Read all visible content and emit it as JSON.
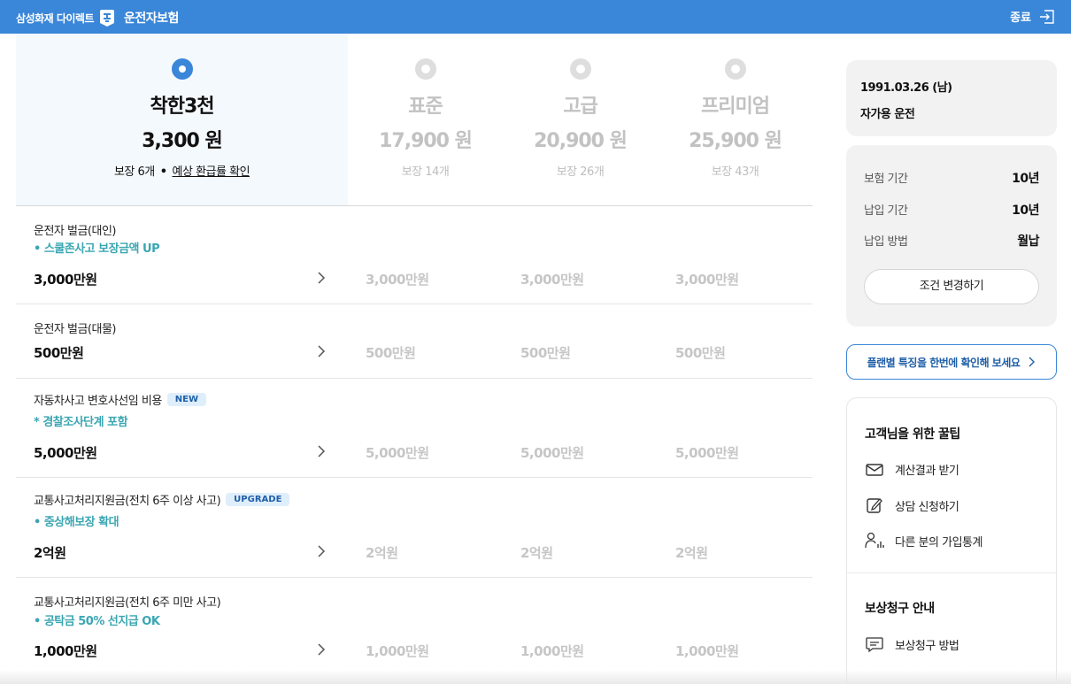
{
  "header": {
    "company": "삼성화재 다이렉트",
    "product": "운전자보험",
    "exit_label": "종료"
  },
  "plans": [
    {
      "name": "착한3천",
      "price": "3,300 원",
      "coverage_count": "보장 6개",
      "refund_link": "예상 환급률 확인",
      "selected": true
    },
    {
      "name": "표준",
      "price": "17,900 원",
      "coverage_count": "보장 14개",
      "selected": false
    },
    {
      "name": "고급",
      "price": "20,900 원",
      "coverage_count": "보장 26개",
      "selected": false
    },
    {
      "name": "프리미엄",
      "price": "25,900 원",
      "coverage_count": "보장 43개",
      "selected": false
    }
  ],
  "coverages": [
    {
      "name": "운전자 벌금(대인)",
      "note": "• 스쿨존사고 보장금액 UP",
      "values": [
        "3,000만원",
        "3,000만원",
        "3,000만원",
        "3,000만원"
      ]
    },
    {
      "name": "운전자 벌금(대물)",
      "values": [
        "500만원",
        "500만원",
        "500만원",
        "500만원"
      ]
    },
    {
      "name": "자동차사고 변호사선임 비용",
      "badge": "NEW",
      "note": "* 경찰조사단계 포함",
      "values": [
        "5,000만원",
        "5,000만원",
        "5,000만원",
        "5,000만원"
      ]
    },
    {
      "name": "교통사고처리지원금(전치 6주 이상 사고)",
      "badge": "UPGRADE",
      "note": "• 중상해보장 확대",
      "values": [
        "2억원",
        "2억원",
        "2억원",
        "2억원"
      ]
    },
    {
      "name": "교통사고처리지원금(전치 6주 미만 사고)",
      "note": "• 공탁금 50% 선지급 OK",
      "values": [
        "1,000만원",
        "1,000만원",
        "1,000만원",
        "1,000만원"
      ]
    }
  ],
  "profile": {
    "birth": "1991.03.26 (남)",
    "usage": "자가용 운전"
  },
  "conditions": {
    "items": [
      {
        "label": "보험 기간",
        "value": "10년"
      },
      {
        "label": "납입 기간",
        "value": "10년"
      },
      {
        "label": "납입 방법",
        "value": "월납"
      }
    ],
    "change_button": "조건 변경하기"
  },
  "features_link": "플랜별 특징을 한번에 확인해 보세요",
  "tips": {
    "title": "고객님을 위한 꿀팁",
    "items": [
      {
        "label": "계산결과 받기",
        "icon": "mail-icon"
      },
      {
        "label": "상담 신청하기",
        "icon": "edit-icon"
      },
      {
        "label": "다른 분의 가입통계",
        "icon": "people-stats-icon"
      }
    ],
    "claim_title": "보상청구 안내",
    "claim_items": [
      {
        "label": "보상청구 방법",
        "icon": "chat-icon"
      }
    ]
  },
  "colors": {
    "primary": "#3a86d8",
    "accent_teal": "#3aa6b2",
    "badge_bg": "#dfeefb",
    "badge_text": "#1f5fa8"
  }
}
